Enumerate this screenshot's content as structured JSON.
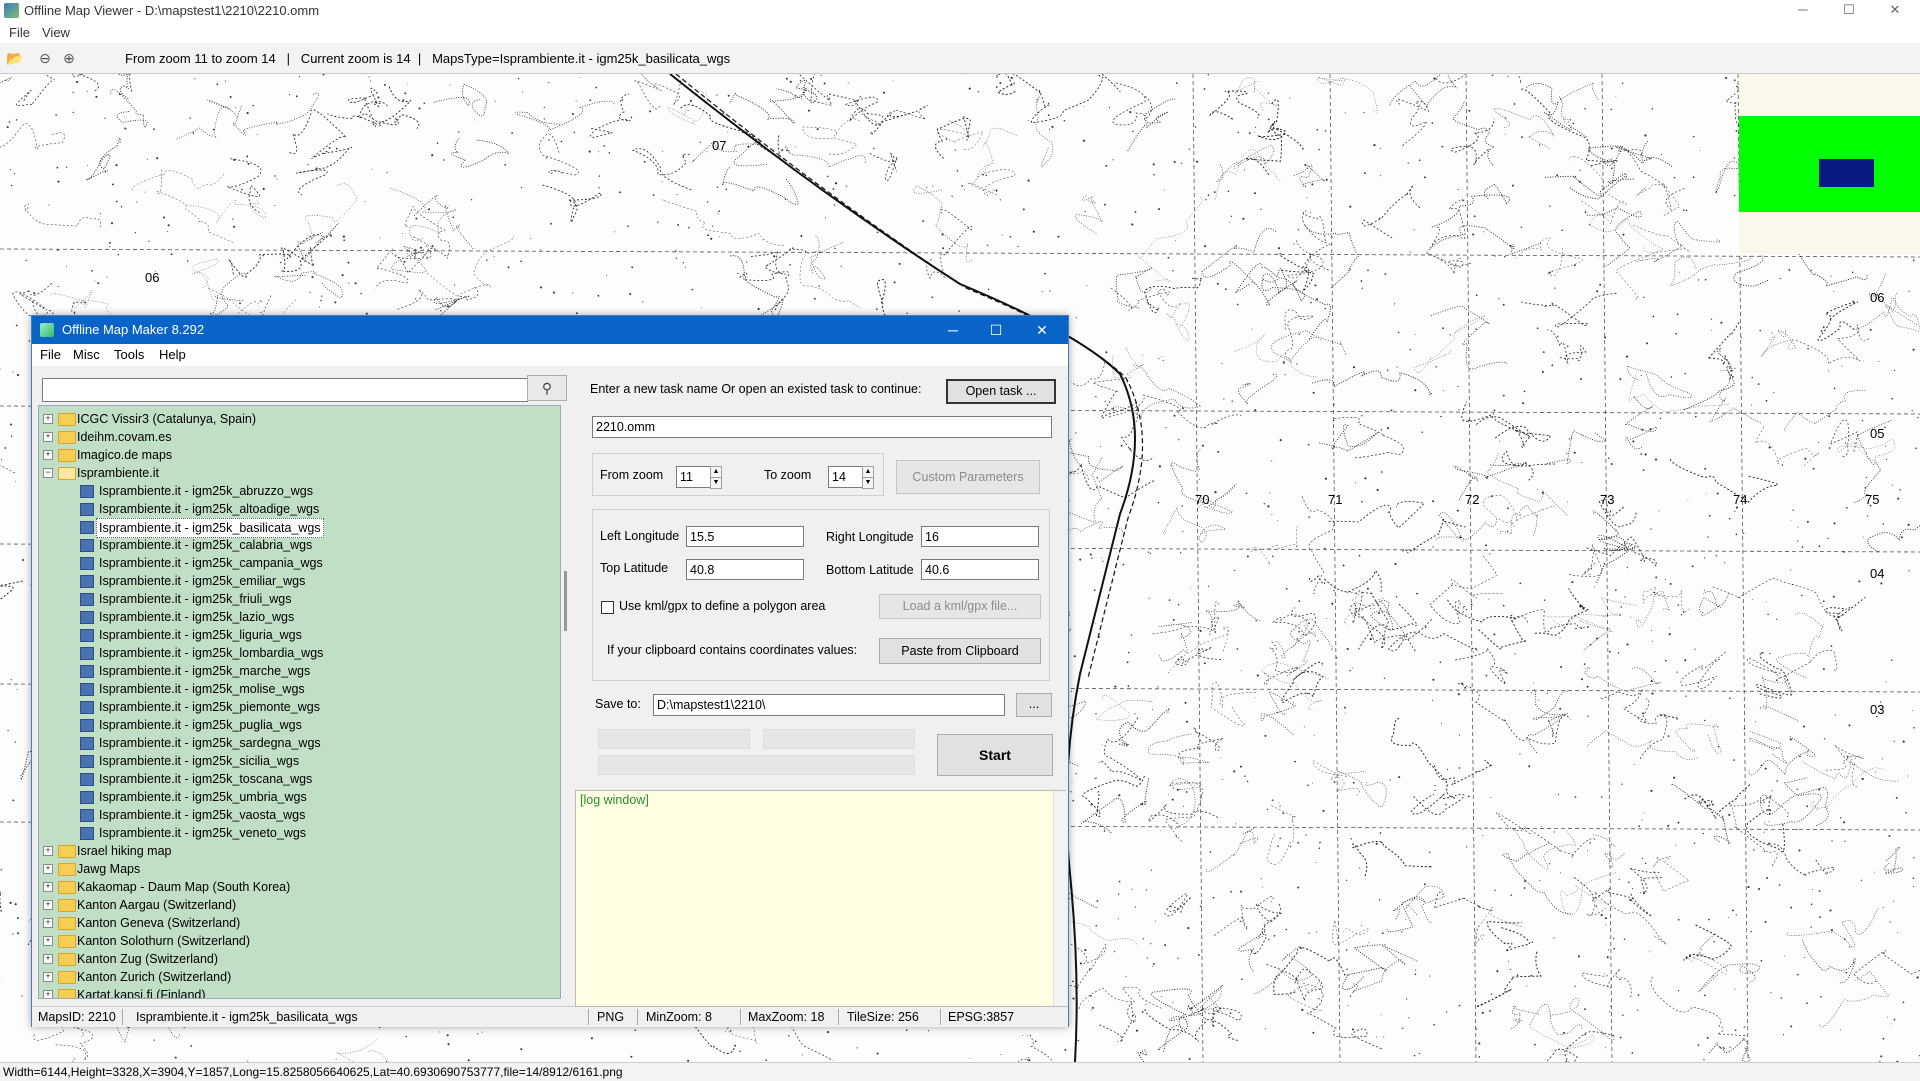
{
  "window": {
    "title": "Offline Map Viewer - D:\\mapstest1\\2210\\2210.omm",
    "controls": {
      "minimize": "─",
      "maximize": "☐",
      "close": "✕"
    }
  },
  "menu": [
    "File",
    "View"
  ],
  "toolbar": {
    "icons": [
      "folder-open-icon",
      "zoom-out-icon",
      "zoom-in-icon"
    ],
    "info": "From zoom 11 to zoom 14   |   Current zoom is 14  |   MapsType=Isprambiente.it - igm25k_basilicata_wgs"
  },
  "map": {
    "grid_labels": [
      "07",
      "06",
      "06",
      "05",
      "04",
      "03",
      "70",
      "71",
      "72",
      "73",
      "74",
      "75"
    ],
    "overview_colors": {
      "background": "#fbf7ea",
      "extent": "#00ff00",
      "viewport": "#0a1a85"
    }
  },
  "statusbar": "Width=6144,Height=3328,X=3904,Y=1857,Long=15.8258056640625,Lat=40.6930690753777,file=14/8912/6161.png",
  "dialog": {
    "title": "Offline Map Maker 8.292",
    "controls": {
      "minimize": "─",
      "maximize": "☐",
      "close": "✕"
    },
    "menu": [
      "File",
      "Misc",
      "Tools",
      "Help"
    ],
    "search": {
      "value": "",
      "icon": "search-icon"
    },
    "tree": [
      {
        "label": "ICGC Vissir3 (Catalunya, Spain)",
        "type": "folder",
        "level": 0,
        "expanded": false
      },
      {
        "label": "Ideihm.covam.es",
        "type": "folder",
        "level": 0,
        "expanded": false
      },
      {
        "label": "Imagico.de maps",
        "type": "folder",
        "level": 0,
        "expanded": false
      },
      {
        "label": "Isprambiente.it",
        "type": "folder",
        "level": 0,
        "expanded": true
      },
      {
        "label": "Isprambiente.it - igm25k_abruzzo_wgs",
        "type": "map",
        "level": 1
      },
      {
        "label": "Isprambiente.it - igm25k_altoadige_wgs",
        "type": "map",
        "level": 1
      },
      {
        "label": "Isprambiente.it - igm25k_basilicata_wgs",
        "type": "map",
        "level": 1,
        "selected": true
      },
      {
        "label": "Isprambiente.it - igm25k_calabria_wgs",
        "type": "map",
        "level": 1
      },
      {
        "label": "Isprambiente.it - igm25k_campania_wgs",
        "type": "map",
        "level": 1
      },
      {
        "label": "Isprambiente.it - igm25k_emiliar_wgs",
        "type": "map",
        "level": 1
      },
      {
        "label": "Isprambiente.it - igm25k_friuli_wgs",
        "type": "map",
        "level": 1
      },
      {
        "label": "Isprambiente.it - igm25k_lazio_wgs",
        "type": "map",
        "level": 1
      },
      {
        "label": "Isprambiente.it - igm25k_liguria_wgs",
        "type": "map",
        "level": 1
      },
      {
        "label": "Isprambiente.it - igm25k_lombardia_wgs",
        "type": "map",
        "level": 1
      },
      {
        "label": "Isprambiente.it - igm25k_marche_wgs",
        "type": "map",
        "level": 1
      },
      {
        "label": "Isprambiente.it - igm25k_molise_wgs",
        "type": "map",
        "level": 1
      },
      {
        "label": "Isprambiente.it - igm25k_piemonte_wgs",
        "type": "map",
        "level": 1
      },
      {
        "label": "Isprambiente.it - igm25k_puglia_wgs",
        "type": "map",
        "level": 1
      },
      {
        "label": "Isprambiente.it - igm25k_sardegna_wgs",
        "type": "map",
        "level": 1
      },
      {
        "label": "Isprambiente.it - igm25k_sicilia_wgs",
        "type": "map",
        "level": 1
      },
      {
        "label": "Isprambiente.it - igm25k_toscana_wgs",
        "type": "map",
        "level": 1
      },
      {
        "label": "Isprambiente.it - igm25k_umbria_wgs",
        "type": "map",
        "level": 1
      },
      {
        "label": "Isprambiente.it - igm25k_vaosta_wgs",
        "type": "map",
        "level": 1
      },
      {
        "label": "Isprambiente.it - igm25k_veneto_wgs",
        "type": "map",
        "level": 1
      },
      {
        "label": "Israel hiking map",
        "type": "folder",
        "level": 0,
        "expanded": false
      },
      {
        "label": "Jawg Maps",
        "type": "folder",
        "level": 0,
        "expanded": false
      },
      {
        "label": "Kakaomap - Daum Map (South Korea)",
        "type": "folder",
        "level": 0,
        "expanded": false
      },
      {
        "label": "Kanton Aargau (Switzerland)",
        "type": "folder",
        "level": 0,
        "expanded": false
      },
      {
        "label": "Kanton Geneva (Switzerland)",
        "type": "folder",
        "level": 0,
        "expanded": false
      },
      {
        "label": "Kanton Solothurn (Switzerland)",
        "type": "folder",
        "level": 0,
        "expanded": false
      },
      {
        "label": "Kanton Zug (Switzerland)",
        "type": "folder",
        "level": 0,
        "expanded": false
      },
      {
        "label": "Kanton Zurich (Switzerland)",
        "type": "folder",
        "level": 0,
        "expanded": false
      },
      {
        "label": "Kartat.kapsi.fi (Finland)",
        "type": "folder",
        "level": 0,
        "expanded": false
      }
    ],
    "task": {
      "prompt": "Enter a new task name Or open an existed task to continue:",
      "open_button": "Open task ...",
      "name_value": "2210.omm"
    },
    "zoom": {
      "from_label": "From zoom",
      "from_value": "11",
      "to_label": "To zoom",
      "to_value": "14",
      "custom_button": "Custom Parameters"
    },
    "coords": {
      "left_lon_label": "Left Longitude",
      "left_lon": "15.5",
      "right_lon_label": "Right Longitude",
      "right_lon": "16",
      "top_lat_label": "Top Latitude",
      "top_lat": "40.8",
      "bottom_lat_label": "Bottom Latitude",
      "bottom_lat": "40.6",
      "kml_label": "Use kml/gpx to define a polygon area",
      "kml_checked": false,
      "kml_button": "Load a kml/gpx file...",
      "clipboard_label": "If your clipboard contains coordinates values:",
      "clipboard_button": "Paste from Clipboard"
    },
    "save": {
      "label": "Save to:",
      "value": "D:\\mapstest1\\2210\\",
      "browse": "..."
    },
    "start_button": "Start",
    "log": "[log window]",
    "status": {
      "maps_id": "MapsID: 2210",
      "maps_name": "Isprambiente.it - igm25k_basilicata_wgs",
      "format": "PNG",
      "min_zoom": "MinZoom: 8",
      "max_zoom": "MaxZoom: 18",
      "tile_size": "TileSize: 256",
      "epsg": "EPSG:3857"
    }
  }
}
